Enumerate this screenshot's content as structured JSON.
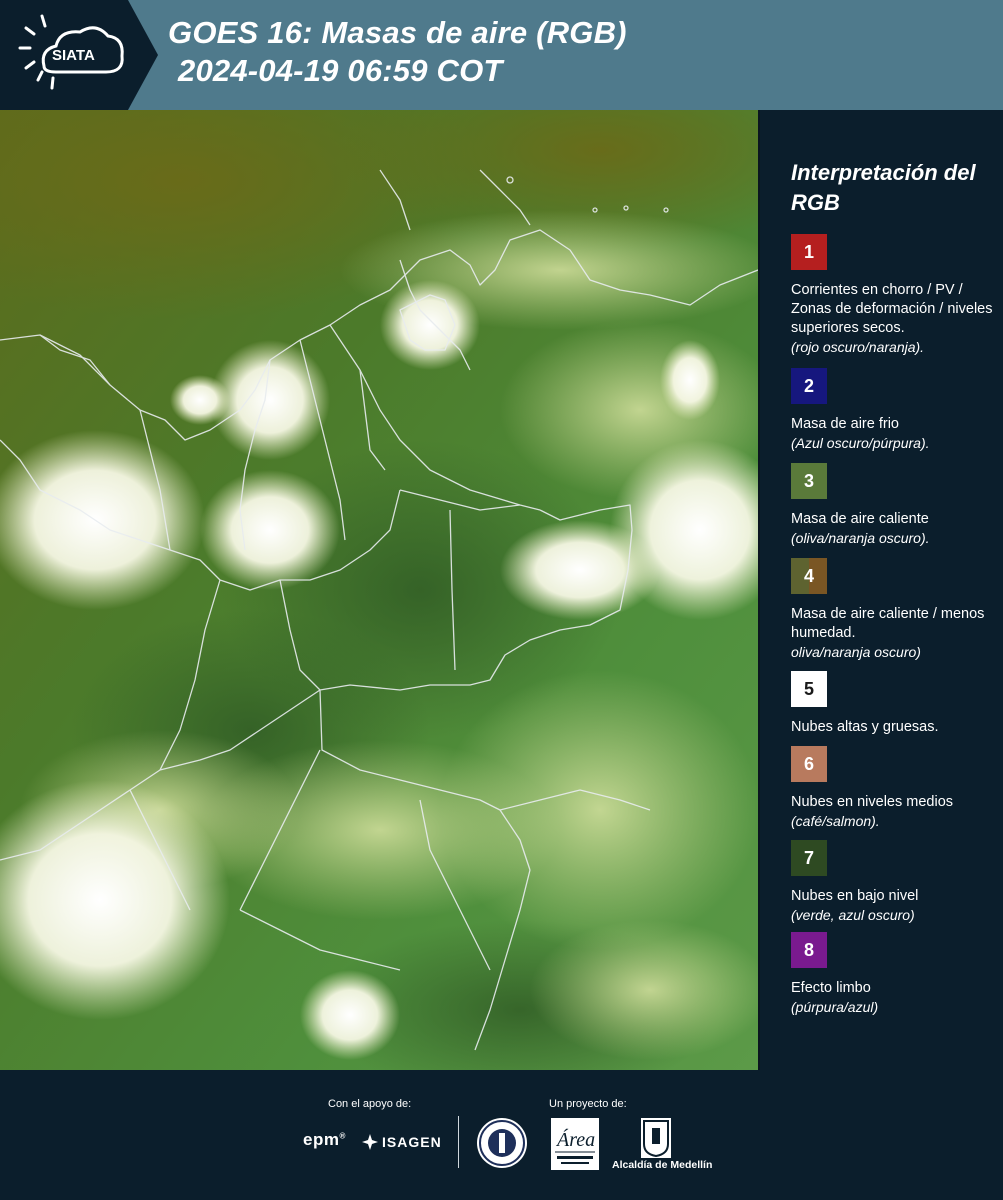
{
  "header": {
    "brand": "SIATA",
    "title_line1": "GOES 16: Masas de aire (RGB)",
    "title_line2": "2024-04-19 06:59 COT"
  },
  "legend": {
    "title": "Interpretación del RGB",
    "items": [
      {
        "number": "1",
        "color": "#b51f1f",
        "description": "Corrientes en chorro / PV / Zonas de deformación / niveles superiores secos.",
        "note": "(rojo oscuro/naranja)."
      },
      {
        "number": "2",
        "color": "#16177e",
        "description": "Masa de aire frio",
        "note": "(Azul oscuro/púrpura)."
      },
      {
        "number": "3",
        "color": "#5a7a3a",
        "description": "Masa de aire caliente",
        "note": "(oliva/naranja oscuro)."
      },
      {
        "number": "4",
        "color": "#6b5a2e",
        "description": "Masa de aire caliente / menos humedad.",
        "note": "oliva/naranja oscuro)"
      },
      {
        "number": "5",
        "color": "#ffffff",
        "description": "Nubes altas y gruesas.",
        "note": ""
      },
      {
        "number": "6",
        "color": "#b87a5e",
        "description": "Nubes en niveles medios",
        "note": "(café/salmon)."
      },
      {
        "number": "7",
        "color": "#2e4a22",
        "description": "Nubes en bajo nivel",
        "note": "(verde, azul oscuro)"
      },
      {
        "number": "8",
        "color": "#7a1a8f",
        "description": "Efecto limbo",
        "note": "(púrpura/azul)"
      }
    ]
  },
  "footer": {
    "support_label": "Con el apoyo de:",
    "project_label": "Un proyecto de:",
    "sponsor1": "epm",
    "sponsor2": "ISAGEN",
    "partner_alcaldia": "Alcaldía de Medellín"
  },
  "colors": {
    "header_bg": "#4f7a8c",
    "panel_bg": "#0b1e2c",
    "map_green": "#4e8c3a",
    "map_olive": "#5f6e1c",
    "cloud_white": "#ffffff"
  }
}
